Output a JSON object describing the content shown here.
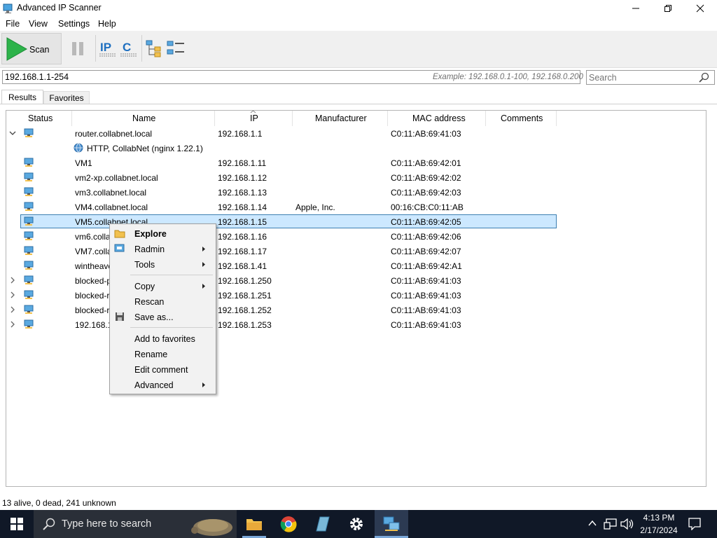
{
  "window": {
    "title": "Advanced IP Scanner"
  },
  "menu": [
    "File",
    "View",
    "Settings",
    "Help"
  ],
  "toolbar": {
    "scan_label": "Scan"
  },
  "address": {
    "ip_range": "192.168.1.1-254",
    "example": "Example: 192.168.0.1-100, 192.168.0.200",
    "search_placeholder": "Search"
  },
  "tabs": [
    "Results",
    "Favorites"
  ],
  "columns": [
    "Status",
    "Name",
    "IP",
    "Manufacturer",
    "MAC address",
    "Comments"
  ],
  "rows": [
    {
      "name": "router.collabnet.local",
      "ip": "192.168.1.1",
      "manufacturer": "",
      "mac": "C0:11:AB:69:41:03"
    },
    {
      "name": "HTTP, CollabNet (nginx 1.22.1)",
      "ip": "",
      "manufacturer": "",
      "mac": ""
    },
    {
      "name": "VM1",
      "ip": "192.168.1.11",
      "manufacturer": "",
      "mac": "C0:11:AB:69:42:01"
    },
    {
      "name": "vm2-xp.collabnet.local",
      "ip": "192.168.1.12",
      "manufacturer": "",
      "mac": "C0:11:AB:69:42:02"
    },
    {
      "name": "vm3.collabnet.local",
      "ip": "192.168.1.13",
      "manufacturer": "",
      "mac": "C0:11:AB:69:42:03"
    },
    {
      "name": "VM4.collabnet.local",
      "ip": "192.168.1.14",
      "manufacturer": "Apple, Inc.",
      "mac": "00:16:CB:C0:11:AB"
    },
    {
      "name": "VM5.collabnet.local",
      "ip": "192.168.1.15",
      "manufacturer": "",
      "mac": "C0:11:AB:69:42:05"
    },
    {
      "name": "vm6.colla",
      "ip": "192.168.1.16",
      "manufacturer": "",
      "mac": "C0:11:AB:69:42:06"
    },
    {
      "name": "VM7.colla",
      "ip": "192.168.1.17",
      "manufacturer": "",
      "mac": "C0:11:AB:69:42:07"
    },
    {
      "name": "wintheave",
      "ip": "192.168.1.41",
      "manufacturer": "",
      "mac": "C0:11:AB:69:42:A1"
    },
    {
      "name": "blocked-p",
      "ip": "192.168.1.250",
      "manufacturer": "",
      "mac": "C0:11:AB:69:41:03"
    },
    {
      "name": "blocked-r",
      "ip": "192.168.1.251",
      "manufacturer": "",
      "mac": "C0:11:AB:69:41:03"
    },
    {
      "name": "blocked-r",
      "ip": "192.168.1.252",
      "manufacturer": "",
      "mac": "C0:11:AB:69:41:03"
    },
    {
      "name": "192.168.1.",
      "ip": "192.168.1.253",
      "manufacturer": "",
      "mac": "C0:11:AB:69:41:03"
    }
  ],
  "context_menu": {
    "explore": "Explore",
    "radmin": "Radmin",
    "tools": "Tools",
    "copy": "Copy",
    "rescan": "Rescan",
    "save_as": "Save as...",
    "add_to_favorites": "Add to favorites",
    "rename": "Rename",
    "edit_comment": "Edit comment",
    "advanced": "Advanced"
  },
  "status": "13 alive, 0 dead, 241 unknown",
  "taskbar": {
    "search_text": "Type here to search",
    "time": "4:13 PM",
    "date": "2/17/2024"
  },
  "colors": {
    "selection": "#cce8ff",
    "taskbar": "#101827",
    "scan_green": "#2db34a"
  }
}
